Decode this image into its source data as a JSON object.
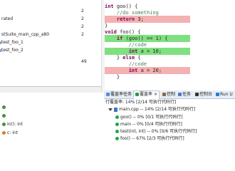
{
  "left_tree": {
    "rows": [
      {
        "label": "",
        "count": "2"
      },
      {
        "label": "rated",
        "count": "2"
      },
      {
        "label": "",
        "count": "2"
      },
      {
        "label": "stSuite_main_cpp_a80",
        "count": "2"
      },
      {
        "label": "test_foo_1",
        "count": ""
      },
      {
        "label": "test_foo_2",
        "count": ""
      }
    ],
    "side_number": "49"
  },
  "left_bottom": {
    "items": [
      {
        "label": ""
      },
      {
        "label": ""
      },
      {
        "label": "in(): int"
      },
      {
        "label": "c: int"
      }
    ]
  },
  "editor": {
    "lines": [
      {
        "parts": [
          {
            "t": "kw",
            "v": "int"
          },
          {
            "t": "txt",
            "v": " goo() {"
          }
        ],
        "bg": ""
      },
      {
        "parts": [
          {
            "t": "cm",
            "v": "    //do something"
          }
        ],
        "bg": ""
      },
      {
        "parts": [
          {
            "t": "kw",
            "v": "    return"
          },
          {
            "t": "txt",
            "v": " 3;"
          }
        ],
        "bg": "red"
      },
      {
        "parts": [
          {
            "t": "txt",
            "v": "}"
          }
        ],
        "bg": ""
      },
      {
        "parts": [],
        "bg": ""
      },
      {
        "parts": [
          {
            "t": "kw",
            "v": "void"
          },
          {
            "t": "txt",
            "v": " foo() {"
          }
        ],
        "bg": ""
      },
      {
        "parts": [
          {
            "t": "kw",
            "v": "    if"
          },
          {
            "t": "txt",
            "v": " (goo() == 1) {"
          }
        ],
        "bg": "green"
      },
      {
        "parts": [
          {
            "t": "cm",
            "v": "        //code"
          }
        ],
        "bg": ""
      },
      {
        "parts": [
          {
            "t": "kw",
            "v": "        int"
          },
          {
            "t": "txt",
            "v": " a = 10;"
          }
        ],
        "bg": "green"
      },
      {
        "parts": [
          {
            "t": "txt",
            "v": "    } "
          },
          {
            "t": "kw",
            "v": "else"
          },
          {
            "t": "txt",
            "v": " {"
          }
        ],
        "bg": ""
      },
      {
        "parts": [
          {
            "t": "cm",
            "v": "        //code"
          }
        ],
        "bg": ""
      },
      {
        "parts": [
          {
            "t": "kw",
            "v": "        int"
          },
          {
            "t": "txt",
            "v": " a = 20;"
          }
        ],
        "bg": "red"
      },
      {
        "parts": [
          {
            "t": "txt",
            "v": "    }"
          }
        ],
        "bg": ""
      }
    ]
  },
  "tabs": [
    {
      "label": "覆盖率任务",
      "color": "#5a8ad4",
      "active": false
    },
    {
      "label": "覆盖率",
      "color": "#2d9b4a",
      "active": true
    },
    {
      "label": "控制",
      "color": "#8a6a3a",
      "active": false
    },
    {
      "label": "任务",
      "color": "#4a79c8",
      "active": false
    },
    {
      "label": "控制台",
      "color": "#333333",
      "active": false
    },
    {
      "label": "Run U",
      "color": "#2a7ad8",
      "active": false
    }
  ],
  "coverage": {
    "summary": "行覆盖率: 14% [2/14 可执行代码行]",
    "file": "main.cpp -- 14% [2/14 可执行代码行]",
    "functions": [
      "goo() -- 0% [0/1 可执行代码行]",
      "main -- 0% [0/4 可执行代码行]",
      "test(int, int) -- 0% [0/6 可执行代码行]",
      "foo() -- 67% [2/3 可执行代码行]"
    ]
  }
}
